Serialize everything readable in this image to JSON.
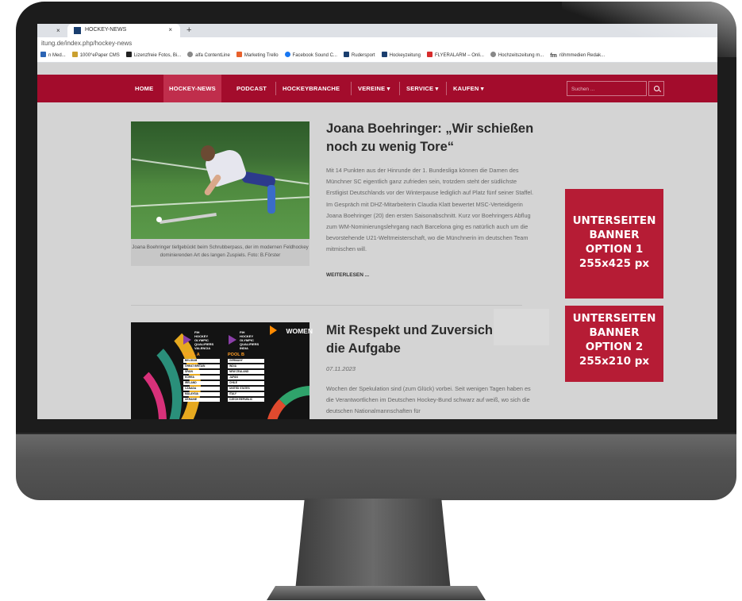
{
  "browser": {
    "tab_title": "HOCKEY-NEWS",
    "tab_close_prev": "×",
    "tab_close": "×",
    "new_tab": "+",
    "url": "itung.de/index.php/hockey-news",
    "bookmarks": [
      {
        "label": "n Med...",
        "icon": "blue"
      },
      {
        "label": "1000°ePaper CMS",
        "icon": "gold"
      },
      {
        "label": "Lizenzfreie Fotos, Bi...",
        "icon": "dark"
      },
      {
        "label": "alfa ContentLine",
        "icon": "grey"
      },
      {
        "label": "Marketing Trello",
        "icon": "orange"
      },
      {
        "label": "Facebook Sound C...",
        "icon": "fb"
      },
      {
        "label": "Rudersport",
        "icon": "navy"
      },
      {
        "label": "Hockeyzeitung",
        "icon": "navy"
      },
      {
        "label": "FLYERALARM – Onli...",
        "icon": "red"
      },
      {
        "label": "Hochzeitszeitung m...",
        "icon": "grey"
      },
      {
        "label": "röhmmedien Redak...",
        "icon": "fm"
      }
    ]
  },
  "nav": {
    "home": "HOME",
    "hockey_news": "HOCKEY-NEWS",
    "podcast": "PODCAST",
    "hockeybranche": "HOCKEYBRANCHE",
    "vereine": "VEREINE ▾",
    "service": "SERVICE ▾",
    "kaufen": "KAUFEN ▾",
    "search_placeholder": "Suchen ..."
  },
  "article1": {
    "title": "Joana Boehringer: „Wir schießen noch zu wenig Tore“",
    "body": "Mit 14 Punkten aus der Hinrunde der 1. Bundesliga können die Damen des Münchner SC eigentlich ganz zufrieden sein, trotzdem steht der südlichste Erstligist Deutschlands vor der Winterpause lediglich auf Platz fünf seiner Staffel. Im Gespräch mit DHZ-Mitarbeiterin Claudia Klatt bewertet MSC-Verteidigerin Joana Boehringer (20) den ersten Saisonabschnitt. Kurz vor Boehringers Abflug zum WM-Nominierungslehrgang nach Barcelona ging es natürlich auch um die bevorstehende U21-Weltmeisterschaft, wo die Münchnerin im deutschen Team mitmischen will.",
    "caption": "Joana Boehringer tiefgebückt beim Schrubberpass, der im modernen Feldhockey dominierenden Art des langen Zuspiels. Foto: B.Förster",
    "read_more": "WEITERLESEN ..."
  },
  "article2": {
    "title": "Mit Respekt und Zuversich die Aufgabe",
    "date": "07.11.2023",
    "body": "Wochen der Spekulation sind (zum Glück) vorbei. Seit wenigen Tagen haben es die Verantwortlichen im Deutschen Hockey-Bund schwarz auf weiß, wo sich die deutschen Nationalmannschaften für",
    "image": {
      "women_label": "WOMEN",
      "brand_a": [
        "FIH",
        "HOCKEY",
        "OLYMPIC",
        "QUALIFIERS",
        "VALENCIA"
      ],
      "brand_b": [
        "FIH",
        "HOCKEY",
        "OLYMPIC",
        "QUALIFIERS",
        "INDIA"
      ],
      "pool_a_title": "POOL A",
      "pool_b_title": "POOL B",
      "pool_a": [
        "BELGIUM",
        "GREAT BRITAIN",
        "SPAIN",
        "KOREA",
        "IRELAND",
        "CANADA",
        "MALAYSIA",
        "UKRAINE"
      ],
      "pool_b": [
        "GERMANY",
        "INDIA",
        "NEW ZEALAND",
        "JAPAN",
        "CHILE",
        "UNITED STATES",
        "ITALY",
        "CZECH REPUBLIC"
      ]
    }
  },
  "banners": {
    "option1": [
      "UNTERSEITEN",
      "BANNER",
      "OPTION 1",
      "255x425 px"
    ],
    "option2": [
      "UNTERSEITEN",
      "BANNER",
      "OPTION 2",
      "255x210 px"
    ]
  },
  "colors": {
    "nav_red": "#a30c2c",
    "banner_red": "#b61c35",
    "page_bg": "#d4d4d4"
  }
}
